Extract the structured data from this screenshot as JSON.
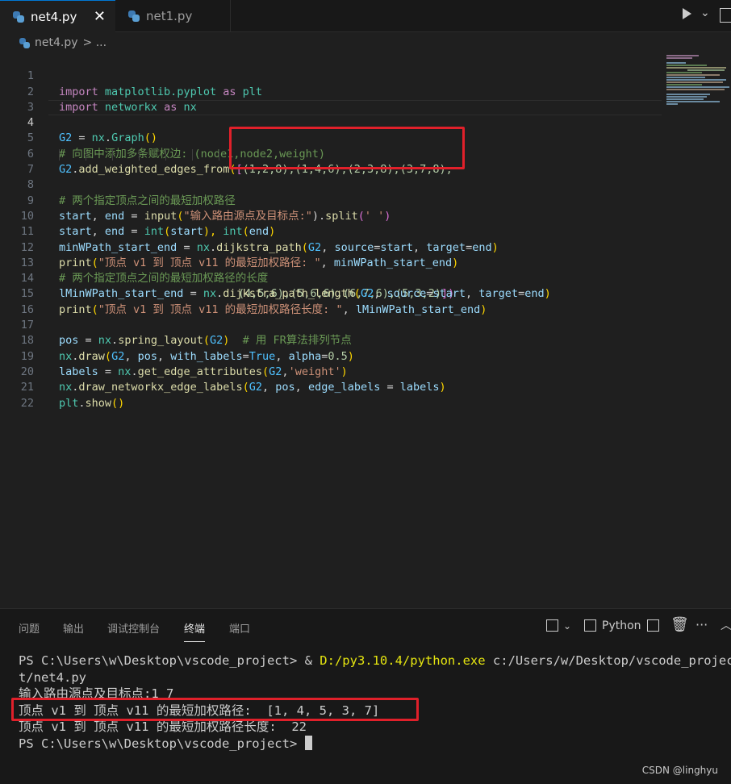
{
  "tabs": [
    {
      "label": "net4.py",
      "active": true,
      "close": "✕"
    },
    {
      "label": "net1.py",
      "active": false
    }
  ],
  "breadcrumb": {
    "file": "net4.py",
    "rest": "> ..."
  },
  "editor": {
    "line_numbers": [
      "1",
      "2",
      "3",
      "4",
      "5",
      "6",
      "7",
      "8",
      "9",
      "10",
      "11",
      "12",
      "13",
      "14",
      "15",
      "16",
      "17",
      "18",
      "19",
      "20",
      "21",
      "22"
    ],
    "current_line": "4",
    "lines": {
      "l1": [
        "import",
        " matplotlib.pyplot ",
        "as",
        " plt"
      ],
      "l2": [
        "import",
        " networkx ",
        "as",
        " nx"
      ],
      "l4": [
        "G2",
        " = ",
        "nx",
        ".",
        "Graph",
        "()"
      ],
      "l5": "# 向图中添加多条赋权边: (node1,node2,weight)",
      "l6": [
        "G2",
        ".",
        "add_weighted_edges_from",
        "(",
        "[",
        "(1,2,8),(1,4,6),(2,3,8),(3,7,8),"
      ],
      "l7": "(4,5,6),(5,6,6),(6,7,6),(5,3,2)",
      "l7_close": "])",
      "l8": "# 两个指定顶点之间的最短加权路径",
      "l9": [
        "start",
        ", ",
        "end",
        " = ",
        "input",
        "(",
        "\"输入路由源点及目标点:\"",
        ").",
        "split",
        "(",
        "' '",
        ")"
      ],
      "l10": [
        "start",
        ", ",
        "end",
        " = ",
        "int",
        "(",
        "start",
        "), ",
        "int",
        "(",
        "end",
        ")"
      ],
      "l11": [
        "minWPath_start_end",
        " = ",
        "nx",
        ".",
        "dijkstra_path",
        "(",
        "G2",
        ", ",
        "source",
        "=",
        "start",
        ", ",
        "target",
        "=",
        "end",
        ")"
      ],
      "l12": [
        "print",
        "(",
        "\"顶点 v1 到 顶点 v11 的最短加权路径: \"",
        ", ",
        "minWPath_start_end",
        ")"
      ],
      "l13": "# 两个指定顶点之间的最短加权路径的长度",
      "l14": [
        "lMinWPath_start_end",
        " = ",
        "nx",
        ".",
        "dijkstra_path_length",
        "(",
        "G2",
        ", ",
        "source",
        "=",
        "start",
        ", ",
        "target",
        "=",
        "end",
        ")"
      ],
      "l15": [
        "print",
        "(",
        "\"顶点 v1 到 顶点 v11 的最短加权路径长度: \"",
        ", ",
        "lMinWPath_start_end",
        ")"
      ],
      "l17": [
        "pos",
        " = ",
        "nx",
        ".",
        "spring_layout",
        "(",
        "G2",
        ")  ",
        "# 用 FR算法排列节点"
      ],
      "l18": [
        "nx",
        ".",
        "draw",
        "(",
        "G2",
        ", ",
        "pos",
        ", ",
        "with_labels",
        "=",
        "True",
        ", ",
        "alpha",
        "=",
        "0.5",
        ")"
      ],
      "l19": [
        "labels",
        " = ",
        "nx",
        ".",
        "get_edge_attributes",
        "(",
        "G2",
        ",",
        "'weight'",
        ")"
      ],
      "l20": [
        "nx",
        ".",
        "draw_networkx_edge_labels",
        "(",
        "G2",
        ", ",
        "pos",
        ", ",
        "edge_labels",
        " = ",
        "labels",
        ")"
      ],
      "l21": [
        "plt",
        ".",
        "show",
        "()"
      ]
    }
  },
  "panel": {
    "tabs": [
      "问题",
      "输出",
      "调试控制台",
      "终端",
      "端口"
    ],
    "active_tab": "终端",
    "shell_label": "Python",
    "more": "···",
    "terminal": {
      "l1_prompt": "PS C:\\Users\\w\\Desktop\\vscode_project> ",
      "l1_amp": "& ",
      "l1_exe": "D:/py3.10.4/python.exe",
      "l1_arg": " c:/Users/w/Desktop/vscode_projec",
      "l2": "t/net4.py",
      "l3": "输入路由源点及目标点:1 7",
      "l4": "顶点 v1 到 顶点 v11 的最短加权路径:  [1, 4, 5, 3, 7]",
      "l5": "顶点 v1 到 顶点 v11 的最短加权路径长度:  22",
      "l6": "PS C:\\Users\\w\\Desktop\\vscode_project> "
    }
  },
  "watermark": "CSDN @linghyu",
  "colors": {
    "highlight_box": "#e0202a",
    "accent": "#0078d4"
  }
}
